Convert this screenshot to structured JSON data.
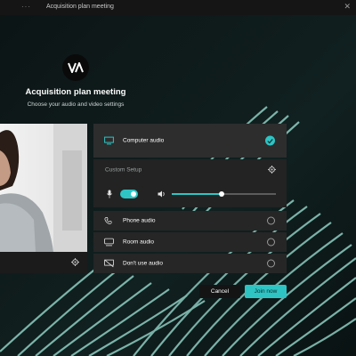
{
  "window": {
    "title": "Acquisition plan meeting",
    "close_glyph": "✕",
    "menu_glyph": "···"
  },
  "meeting": {
    "logo_text": "VA",
    "title": "Acquisition plan meeting",
    "subtitle": "Choose your audio and video settings"
  },
  "audio": {
    "options": [
      {
        "label": "Computer audio",
        "icon": "monitor-icon",
        "selected": true
      },
      {
        "label": "Phone audio",
        "icon": "phone-icon",
        "selected": false
      },
      {
        "label": "Room audio",
        "icon": "room-icon",
        "selected": false
      },
      {
        "label": "Don't use audio",
        "icon": "no-audio-icon",
        "selected": false
      }
    ],
    "custom_setup_label": "Custom Setup",
    "mic_enabled": true,
    "speaker_volume": 0.48
  },
  "buttons": {
    "cancel": "Cancel",
    "join": "Join now"
  },
  "colors": {
    "accent": "#2ec4c4",
    "panel": "#262626",
    "background": "#0e1616"
  }
}
